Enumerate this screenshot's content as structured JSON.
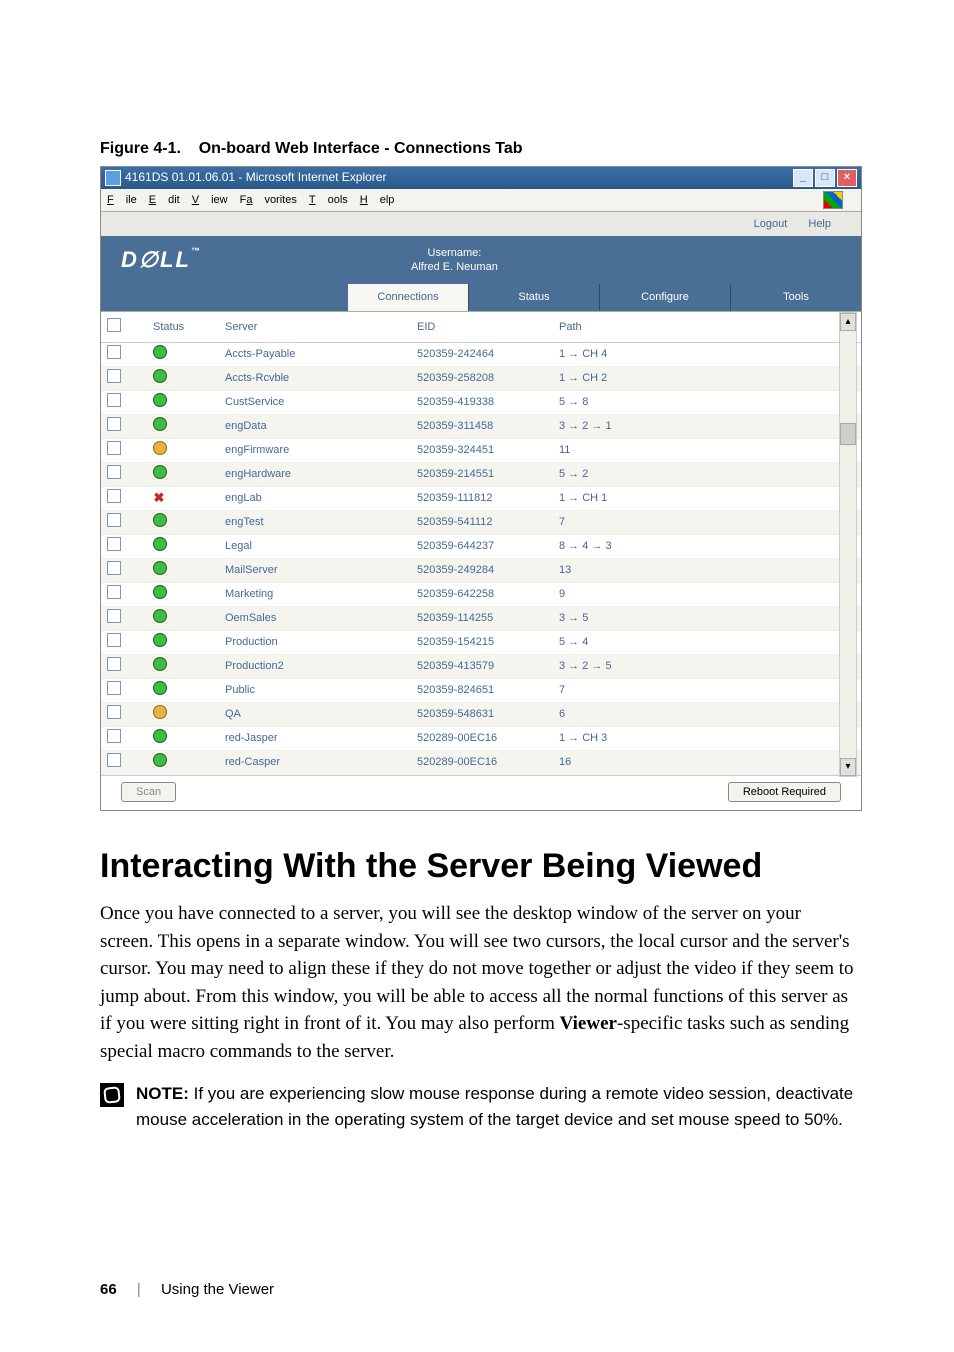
{
  "figure_caption_prefix": "Figure 4-1.",
  "figure_caption_title": "On-board Web Interface - Connections Tab",
  "window": {
    "title": "4161DS 01.01.06.01 - Microsoft Internet Explorer",
    "menus": {
      "file": "File",
      "edit": "Edit",
      "view": "View",
      "favorites": "Favorites",
      "tools": "Tools",
      "help": "Help"
    }
  },
  "topbar": {
    "logout": "Logout",
    "help": "Help"
  },
  "user_block": {
    "label": "Username:",
    "name": "Alfred E. Neuman"
  },
  "tabs": {
    "connections": "Connections",
    "status": "Status",
    "configure": "Configure",
    "tools": "Tools"
  },
  "table": {
    "headers": {
      "status": "Status",
      "server": "Server",
      "eid": "EID",
      "path": "Path"
    },
    "rows": [
      {
        "status": "green",
        "server": "Accts-Payable",
        "eid": "520359-242464",
        "path": "1 → CH 4"
      },
      {
        "status": "green",
        "server": "Accts-Rcvble",
        "eid": "520359-258208",
        "path": "1 → CH 2"
      },
      {
        "status": "green",
        "server": "CustService",
        "eid": "520359-419338",
        "path": "5 → 8"
      },
      {
        "status": "green",
        "server": "engData",
        "eid": "520359-311458",
        "path": "3 → 2 → 1"
      },
      {
        "status": "amber",
        "server": "engFirmware",
        "eid": "520359-324451",
        "path": "11"
      },
      {
        "status": "green",
        "server": "engHardware",
        "eid": "520359-214551",
        "path": "5 → 2"
      },
      {
        "status": "x",
        "server": "engLab",
        "eid": "520359-111812",
        "path": "1 → CH 1"
      },
      {
        "status": "green",
        "server": "engTest",
        "eid": "520359-541112",
        "path": "7"
      },
      {
        "status": "green",
        "server": "Legal",
        "eid": "520359-644237",
        "path": "8 → 4 → 3"
      },
      {
        "status": "green",
        "server": "MailServer",
        "eid": "520359-249284",
        "path": "13"
      },
      {
        "status": "green",
        "server": "Marketing",
        "eid": "520359-642258",
        "path": "9"
      },
      {
        "status": "green",
        "server": "OemSales",
        "eid": "520359-114255",
        "path": "3 → 5"
      },
      {
        "status": "green",
        "server": "Production",
        "eid": "520359-154215",
        "path": "5 → 4"
      },
      {
        "status": "green",
        "server": "Production2",
        "eid": "520359-413579",
        "path": "3 → 2 → 5"
      },
      {
        "status": "green",
        "server": "Public",
        "eid": "520359-824651",
        "path": "7"
      },
      {
        "status": "amber",
        "server": "QA",
        "eid": "520359-548631",
        "path": "6"
      },
      {
        "status": "green",
        "server": "red-Jasper",
        "eid": "520289-00EC16",
        "path": "1 → CH 3"
      },
      {
        "status": "green",
        "server": "red-Casper",
        "eid": "520289-00EC16",
        "path": "16"
      }
    ]
  },
  "buttons": {
    "scan": "Scan",
    "reboot": "Reboot Required"
  },
  "heading": "Interacting With the Server Being Viewed",
  "paragraph_a": "Once you have connected to a server, you will see the desktop window of the server on your screen. This opens in a separate window. You will see two cursors, the local cursor and the server's cursor. You may need to align these if they do not move together or adjust the video if they seem to jump about. From this window, you will be able to access all the normal functions of this server as if you were sitting right in front of it. You may also perform ",
  "paragraph_bold": "Viewer",
  "paragraph_b": "-specific tasks such as sending special macro commands to the server.",
  "note_label": "NOTE:",
  "note_text": " If you are experiencing slow mouse response during a remote video session, deactivate mouse acceleration in the operating system of the target device and set mouse speed to 50%.",
  "footer": {
    "page": "66",
    "section": "Using the Viewer"
  }
}
